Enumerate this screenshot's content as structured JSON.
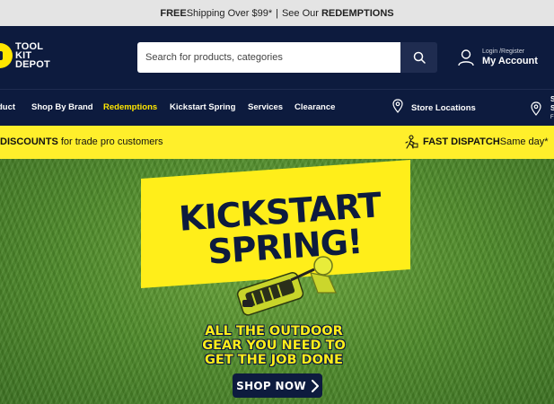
{
  "topbar": {
    "free": "FREE",
    "shipping": " Shipping Over $99*",
    "separator": "|",
    "see_our": "See Our ",
    "redemptions": "REDEMPTIONS"
  },
  "logo": {
    "line1": "TOOL",
    "line2": "KIT",
    "line3": "DEPOT"
  },
  "search": {
    "placeholder": "Search for products, categories"
  },
  "account": {
    "small": "Login /Register",
    "label": "My Account"
  },
  "nav": {
    "items": [
      {
        "label": "duct"
      },
      {
        "label": "Shop By Brand"
      },
      {
        "label": "Redemptions"
      },
      {
        "label": "Kickstart Spring"
      },
      {
        "label": "Services"
      },
      {
        "label": "Clearance"
      }
    ],
    "store_locations": "Store Locations",
    "right_cut_1": "S",
    "right_cut_2": "S",
    "right_cut_3": "F"
  },
  "promo": {
    "left_bold": "DISCOUNTS",
    "left_rest": " for trade pro customers",
    "right_bold": "FAST DISPATCH",
    "right_rest": " Same day*"
  },
  "hero": {
    "title_line1": "KICKSTART",
    "title_line2": "SPRING!",
    "tagline_line1": "ALL THE OUTDOOR",
    "tagline_line2": "GEAR YOU NEED TO",
    "tagline_line3": "GET THE JOB DONE",
    "cta": "SHOP NOW"
  },
  "colors": {
    "navy": "#0d1b3e",
    "yellow": "#ffe600",
    "grass": "#4e8a2a"
  }
}
